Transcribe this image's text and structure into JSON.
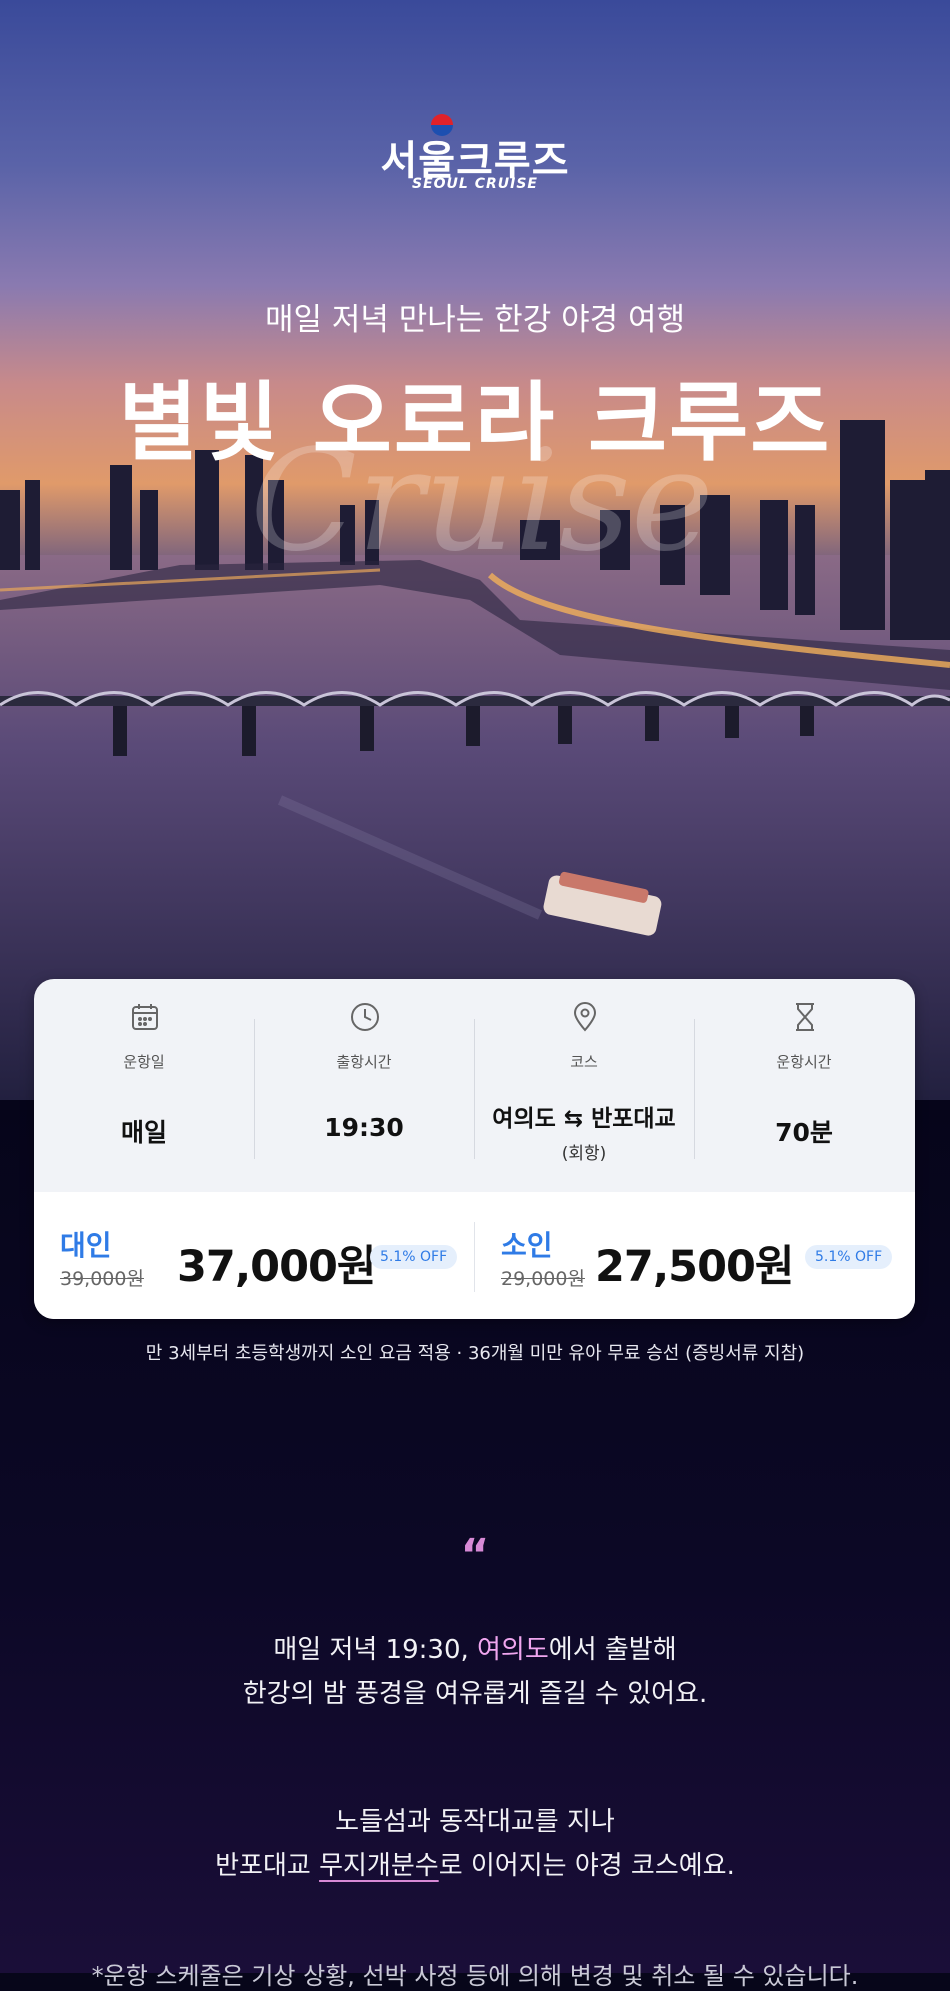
{
  "brand": {
    "name": "서울크루즈",
    "sub": "SEOUL CRUISE"
  },
  "hero": {
    "subtitle": "매일 저녁 만나는 한강 야경 여행",
    "title": "별빛 오로라 크루즈",
    "script": "Cruise"
  },
  "info": [
    {
      "icon": "calendar-icon",
      "label": "운항일",
      "value": "매일",
      "note": ""
    },
    {
      "icon": "clock-icon",
      "label": "출항시간",
      "value": "19:30",
      "note": ""
    },
    {
      "icon": "location-pin-icon",
      "label": "코스",
      "value": "여의도 ⇆ 반포대교",
      "note": "(회항)"
    },
    {
      "icon": "hourglass-icon",
      "label": "운항시간",
      "value": "70분",
      "note": ""
    }
  ],
  "prices": [
    {
      "label": "대인",
      "original": "39,000원",
      "price": "37,000원",
      "badge": "5.1% OFF"
    },
    {
      "label": "소인",
      "original": "29,000원",
      "price": "27,500원",
      "badge": "5.1% OFF"
    }
  ],
  "notice": "만 3세부터 초등학생까지 소인 요금 적용 · 36개월 미만 유아 무료 승선 (증빙서류 지참)",
  "quote_mark": "“",
  "para1": {
    "pre": "매일 저녁 19:30, ",
    "hl": "여의도",
    "post": "에서 출발해",
    "line2": "한강의 밤 풍경을 여유롭게 즐길 수 있어요."
  },
  "para2": {
    "line1": "노들섬과 동작대교를 지나",
    "pre": "반포대교 ",
    "hl": "무지개분수",
    "post": "로 이어지는 야경 코스예요."
  },
  "footnote": "*운항 스케줄은 기상 상황, 선박 사정 등에 의해 변경 및 취소 될 수 있습니다."
}
